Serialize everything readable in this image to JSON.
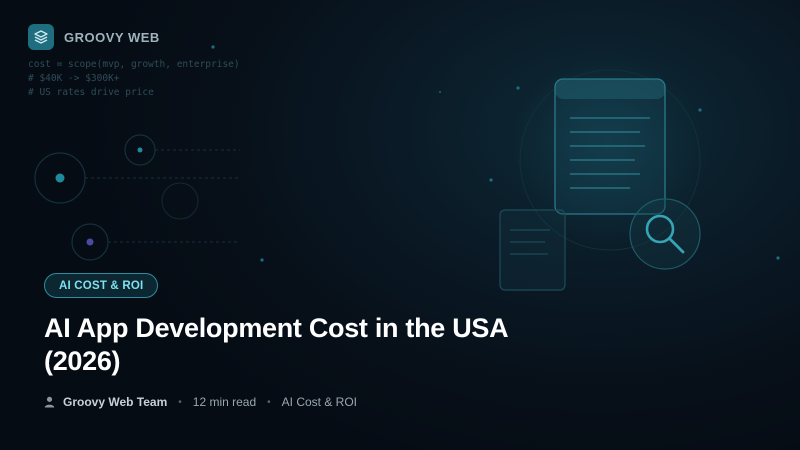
{
  "brand": {
    "name": "GROOVY WEB",
    "accent": "#1f6e80"
  },
  "code_lines": [
    "cost = scope(mvp, growth, enterprise)",
    "# $40K -> $300K+",
    "# US rates drive price"
  ],
  "badge": {
    "label": "AI COST & ROI"
  },
  "title": {
    "line1": "AI App Development Cost in the USA",
    "line2": "(2026)"
  },
  "meta": {
    "author": "Groovy Web Team",
    "read_time": "12 min read",
    "category": "AI Cost & ROI",
    "author_icon": "person-icon"
  },
  "illustration": {
    "icons": [
      "document-icon",
      "magnifier-icon"
    ]
  }
}
